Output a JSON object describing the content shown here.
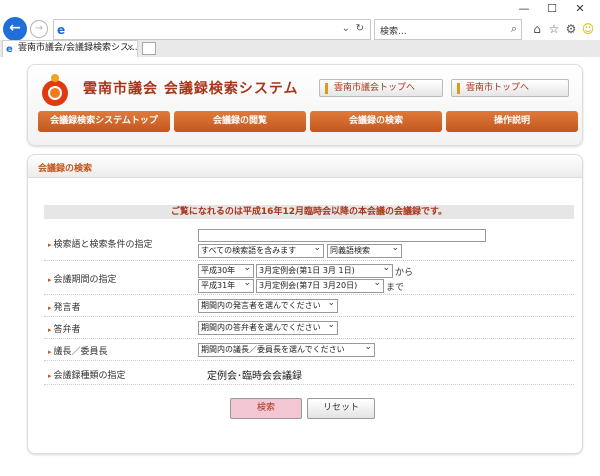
{
  "browser": {
    "window_controls": {
      "minimize": "—",
      "maximize": "☐",
      "close": "✕"
    },
    "address_value": "",
    "address_controls": {
      "dropdown": "⌄",
      "refresh": "↻"
    },
    "search_placeholder": "検索...",
    "tab_title": "雲南市議会/会議録検索シス...",
    "icons": [
      "home-icon",
      "star-icon",
      "gear-icon",
      "smiley-icon"
    ]
  },
  "header": {
    "title": "雲南市議会 会議録検索システム",
    "link_assembly": "雲南市議会トップへ",
    "link_city": "雲南市トップへ",
    "nav": [
      "会議録検索システムトップ",
      "会議録の閲覧",
      "会議録の検索",
      "操作説明"
    ]
  },
  "panel": {
    "title": "会議録の検索",
    "notice": "ご覧になれるのは平成16年12月臨時会以降の本会議の会議録です。"
  },
  "form": {
    "keyword": {
      "label": "検索語と検索条件の指定",
      "input_value": "",
      "condition": "すべての検索語を含みます",
      "synonym": "同義語検索"
    },
    "period": {
      "label": "会議期間の指定",
      "from_year": "平成30年",
      "from_session": "3月定例会(第1日 3月 1日)",
      "from_suffix": "から",
      "to_year": "平成31年",
      "to_session": "3月定例会(第7日 3月20日)",
      "to_suffix": "まで"
    },
    "speaker": {
      "label": "発言者",
      "value": "期間内の発言者を選んでください"
    },
    "respondent": {
      "label": "答弁者",
      "value": "期間内の答弁者を選んでください"
    },
    "chair": {
      "label": "議長／委員長",
      "value": "期間内の議長／委員長を選んでください"
    },
    "meeting_type": {
      "label": "会議録種類の指定",
      "value": "定例会･臨時会会議録"
    },
    "buttons": {
      "search": "検索",
      "reset": "リセット"
    }
  }
}
